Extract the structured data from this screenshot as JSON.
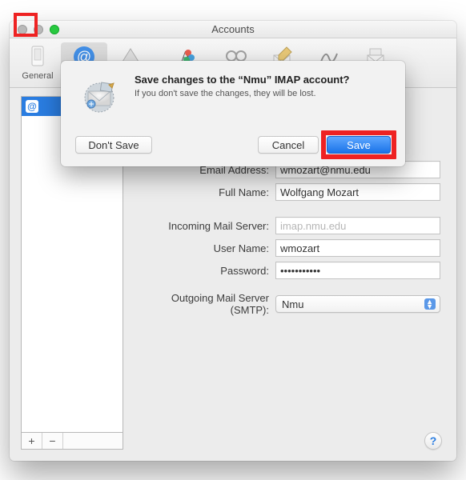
{
  "window": {
    "title": "Accounts"
  },
  "toolbar": {
    "items": [
      {
        "id": "general",
        "label": "General"
      },
      {
        "id": "accounts",
        "label": "Accounts"
      },
      {
        "id": "junkmail",
        "label": "Junk Mail"
      },
      {
        "id": "fonts",
        "label": "Fonts & Colors"
      },
      {
        "id": "viewing",
        "label": "Viewing"
      },
      {
        "id": "composing",
        "label": "Composing"
      },
      {
        "id": "signatures",
        "label": "Signatures"
      },
      {
        "id": "rules",
        "label": "Rules"
      }
    ],
    "selected": "accounts"
  },
  "sidebar": {
    "accounts": [
      {
        "icon": "@",
        "label": ""
      }
    ],
    "buttons": {
      "add": "+",
      "remove": "−"
    }
  },
  "form": {
    "email_label": "Email Address:",
    "email_value": "wmozart@nmu.edu",
    "fullname_label": "Full Name:",
    "fullname_value": "Wolfgang Mozart",
    "incoming_label": "Incoming Mail Server:",
    "incoming_value": "imap.nmu.edu",
    "username_label": "User Name:",
    "username_value": "wmozart",
    "password_label": "Password:",
    "password_value": "•••••••••••",
    "smtp_label": "Outgoing Mail Server (SMTP):",
    "smtp_value": "Nmu"
  },
  "dialog": {
    "title": "Save changes to the “Nmu” IMAP account?",
    "message": "If you don't save the changes, they will be lost.",
    "dont_save": "Don't Save",
    "cancel": "Cancel",
    "save": "Save"
  },
  "help": {
    "glyph": "?"
  }
}
